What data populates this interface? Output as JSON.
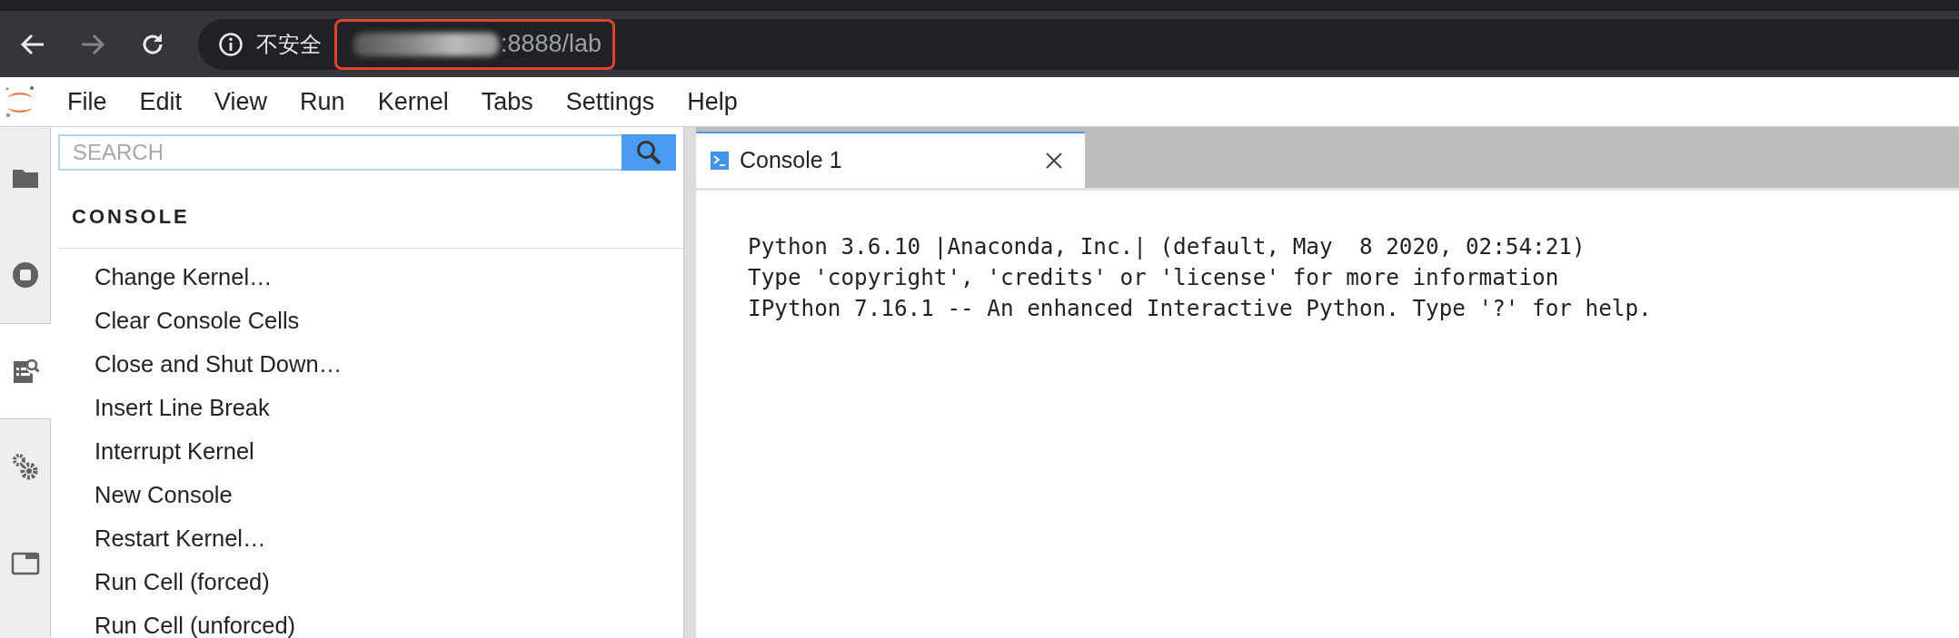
{
  "browser": {
    "security_label": "不安全",
    "address": ":8888/lab",
    "forward_disabled": true
  },
  "menu": [
    "File",
    "Edit",
    "View",
    "Run",
    "Kernel",
    "Tabs",
    "Settings",
    "Help"
  ],
  "activity_bar": [
    {
      "kind": "folder",
      "selected": false
    },
    {
      "kind": "running",
      "selected": false
    },
    {
      "kind": "commands",
      "selected": true
    },
    {
      "kind": "settings",
      "selected": false
    },
    {
      "kind": "tabs",
      "selected": false
    }
  ],
  "sidebar": {
    "search": {
      "placeholder": "SEARCH"
    },
    "section": "CONSOLE",
    "commands": [
      "Change Kernel…",
      "Clear Console Cells",
      "Close and Shut Down…",
      "Insert Line Break",
      "Interrupt Kernel",
      "New Console",
      "Restart Kernel…",
      "Run Cell (forced)",
      "Run Cell (unforced)"
    ]
  },
  "tabs": [
    {
      "label": "Console 1",
      "selected": true
    }
  ],
  "console_output": [
    "Python 3.6.10 |Anaconda, Inc.| (default, May  8 2020, 02:54:21)",
    "Type 'copyright', 'credits' or 'license' for more information",
    "IPython 7.16.1 -- An enhanced Interactive Python. Type '?' for help."
  ]
}
